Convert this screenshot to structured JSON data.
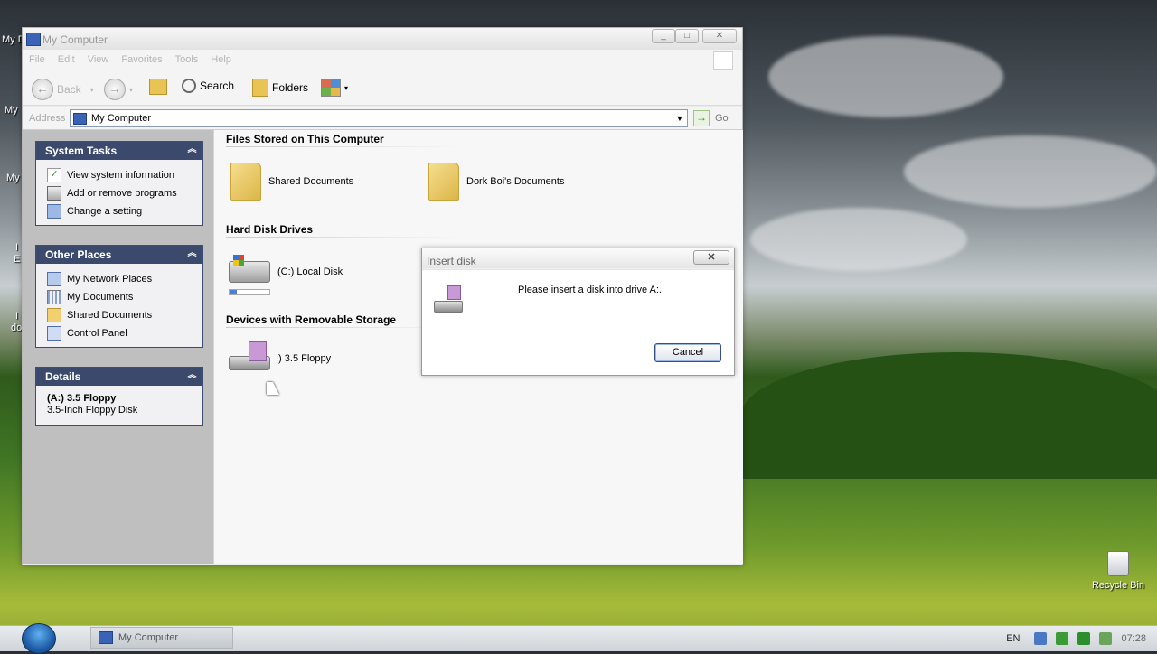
{
  "desktop": {
    "icons": [
      {
        "label": "My D"
      },
      {
        "label": "My"
      },
      {
        "label": "My"
      },
      {
        "label": "I"
      },
      {
        "label": "E"
      },
      {
        "label": "I"
      },
      {
        "label": "do"
      }
    ],
    "recycle_bin": "Recycle Bin"
  },
  "window": {
    "title": "My Computer",
    "controls": {
      "minimize": "_",
      "maximize": "□",
      "close": "✕"
    },
    "menu": [
      "File",
      "Edit",
      "View",
      "Favorites",
      "Tools",
      "Help"
    ],
    "toolbar": {
      "back": "Back",
      "search": "Search",
      "folders": "Folders"
    },
    "address": {
      "label": "Address",
      "value": "My Computer",
      "go": "Go"
    }
  },
  "left_pane": {
    "system_tasks": {
      "title": "System Tasks",
      "items": [
        {
          "label": "View system information",
          "icon": "check-icon"
        },
        {
          "label": "Add or remove programs",
          "icon": "programs-icon"
        },
        {
          "label": "Change a setting",
          "icon": "settings-icon"
        }
      ]
    },
    "other_places": {
      "title": "Other Places",
      "items": [
        {
          "label": "My Network Places",
          "icon": "network-icon"
        },
        {
          "label": "My Documents",
          "icon": "documents-icon"
        },
        {
          "label": "Shared Documents",
          "icon": "folder-icon"
        },
        {
          "label": "Control Panel",
          "icon": "control-panel-icon"
        }
      ]
    },
    "details": {
      "title": "Details",
      "name": "(A:) 3.5 Floppy",
      "type": "3.5-Inch Floppy Disk"
    }
  },
  "content": {
    "sections": {
      "files": "Files Stored on This Computer",
      "hdd": "Hard Disk Drives",
      "removable": "Devices with Removable Storage"
    },
    "files": [
      {
        "label": "Shared Documents"
      },
      {
        "label": "Dork Boi's Documents"
      }
    ],
    "drives": [
      {
        "label": "(C:) Local Disk",
        "used_fraction": 0.18
      }
    ],
    "removable": [
      {
        "label": "(A:) 3.5 Floppy",
        "visible_label": ":) 3.5 Floppy"
      }
    ]
  },
  "dialog": {
    "title": "Insert disk",
    "close": "✕",
    "message": "Please insert a disk into drive A:.",
    "cancel": "Cancel"
  },
  "taskbar": {
    "task": "My Computer",
    "language": "EN",
    "clock": "07:28"
  },
  "colors": {
    "panel_header": "#3b4a6c",
    "accent": "#34508c"
  }
}
